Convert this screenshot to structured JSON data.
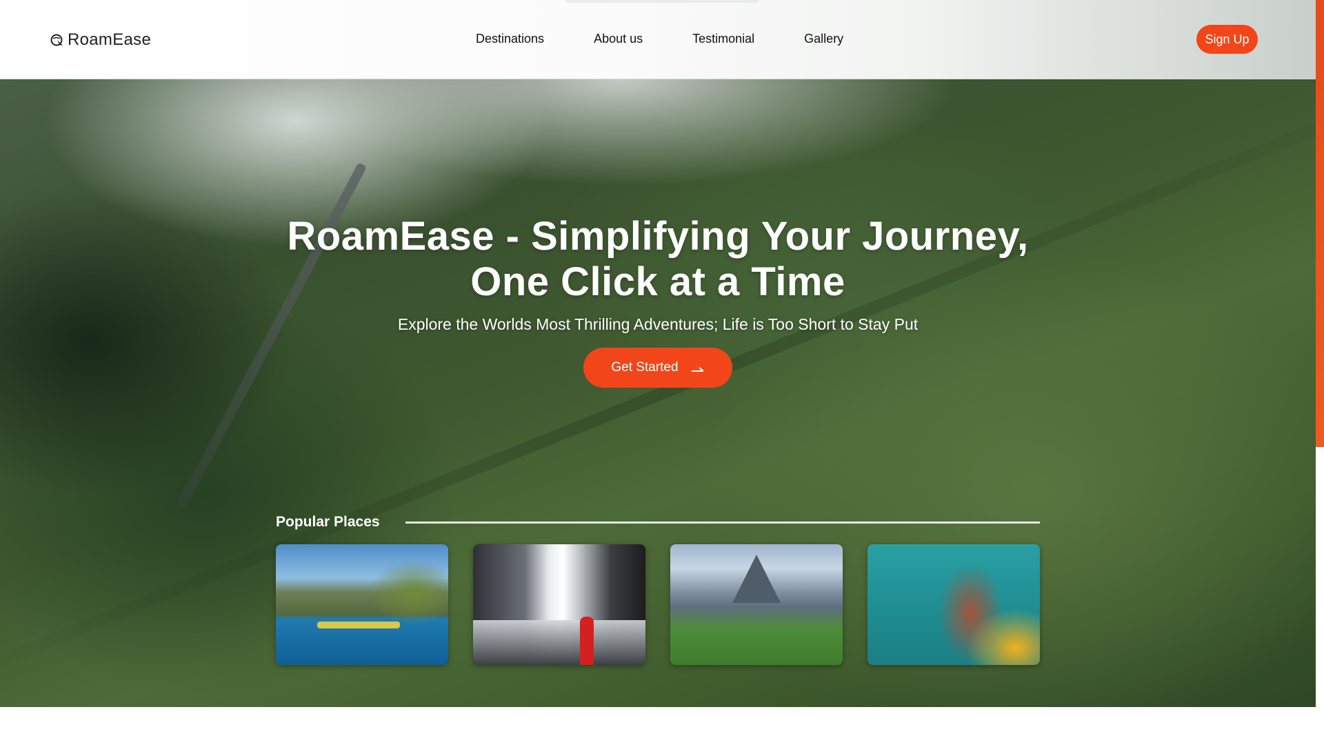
{
  "header": {
    "brand": "RoamEase",
    "nav": [
      "Destinations",
      "About us",
      "Testimonial",
      "Gallery"
    ],
    "signup_label": "Sign Up"
  },
  "hero": {
    "title_line1": "RoamEase - Simplifying Your Journey,",
    "title_line2": "One Click at a Time",
    "subtitle": "Explore the Worlds Most Thrilling Adventures; Life is Too Short to Stay Put",
    "cta_label": "Get Started"
  },
  "popular": {
    "label": "Popular Places",
    "cards": [
      "place-bay-cliffs",
      "place-waterfall",
      "place-mountain-ridge",
      "place-coastal-village"
    ]
  },
  "colors": {
    "accent": "#f2461a",
    "text_dark": "#111111",
    "white": "#ffffff"
  },
  "icons": {
    "brand": "globe-arrow-icon",
    "cta": "arrow-right-icon"
  }
}
